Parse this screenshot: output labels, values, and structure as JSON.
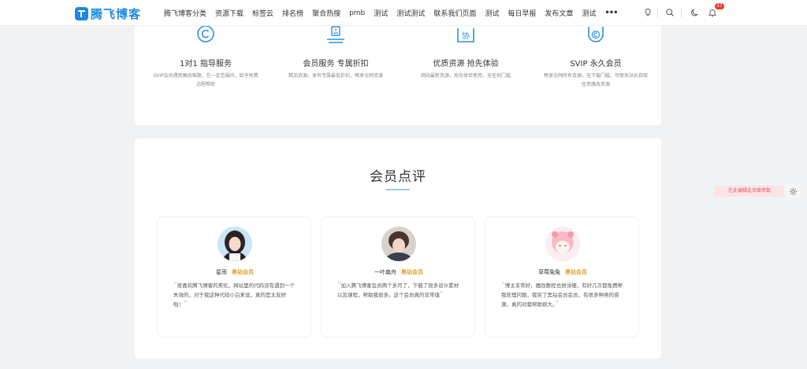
{
  "header": {
    "logo_text": "腾飞博客",
    "nav": [
      "腾飞博客分类",
      "资源下载",
      "标签云",
      "排名榜",
      "聚合热搜",
      "pmb",
      "测试",
      "测试测试",
      "联系我们页面",
      "测试",
      "每日早报",
      "发布文章",
      "测试"
    ],
    "more_icon": "more-dots-icon",
    "notification_count": "37"
  },
  "features": [
    {
      "icon": "copyright-circle-icon",
      "title": "1对1 指导服务",
      "desc": "SVIP会员遇到魔改难题，在一定范围内，给予免费远程帮助"
    },
    {
      "icon": "discount-tag-icon",
      "title": "会员服务 专属折扣",
      "desc": "精品资源，享有专属最低折扣，畅享全网资源"
    },
    {
      "icon": "xie-tag-icon",
      "title": "优质资源 抢先体验",
      "desc": "网站最新资源，抢先体验使用，无任何门槛"
    },
    {
      "icon": "shield-copyright-icon",
      "title": "SVIP 永久会员",
      "desc": "畅享全网所有资源，无下载门槛，可联系站长获取任意魔改资源"
    }
  ],
  "reviews": {
    "title": "会员点评",
    "items": [
      {
        "name": "星雨",
        "badge": "黑钻会员",
        "quote": "很喜欢腾飞博客的美化，网站里的代码没有遇到一个失效的，对于我这种代码小白来说，真的是太友好啦！"
      },
      {
        "name": "一叶扁舟",
        "badge": "黑钻会员",
        "quote": "加入腾飞博客会员两个多月了，下载了很多设计素材以及课程，帮助我很多。这个会员真的非常值"
      },
      {
        "name": "草莓兔兔",
        "badge": "黑钻会员",
        "quote": "博主非常好，魔改教程也很详细，有好几次都免费帮我处理问题，我买了黑钻会员会员，有很多种类的资源，真的对我帮助很大。"
      }
    ]
  },
  "edit_tab": {
    "label": "在此编辑此页面参数"
  },
  "colors": {
    "brand": "#1e88e5",
    "badge_gold": "#e0a02a",
    "notif_red": "#e53935",
    "background": "#f1f2f3"
  }
}
